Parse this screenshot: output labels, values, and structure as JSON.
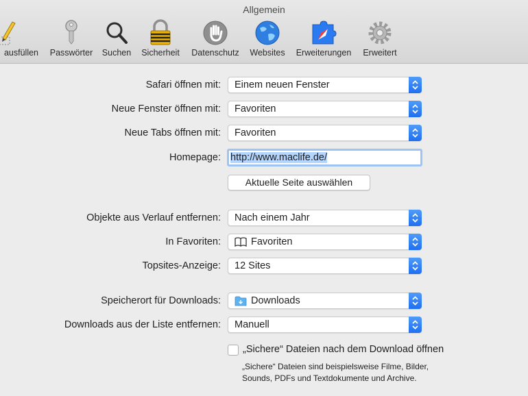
{
  "window": {
    "title": "Allgemein"
  },
  "toolbar": {
    "items": [
      {
        "label": "ausfüllen",
        "icon": "autofill-pencil-icon"
      },
      {
        "label": "Passwörter",
        "icon": "key-icon"
      },
      {
        "label": "Suchen",
        "icon": "magnifier-icon"
      },
      {
        "label": "Sicherheit",
        "icon": "padlock-icon"
      },
      {
        "label": "Datenschutz",
        "icon": "hand-icon"
      },
      {
        "label": "Websites",
        "icon": "globe-icon"
      },
      {
        "label": "Erweiterungen",
        "icon": "puzzle-icon"
      },
      {
        "label": "Erweitert",
        "icon": "gear-icon"
      }
    ]
  },
  "form": {
    "safari_open": {
      "label": "Safari öffnen mit:",
      "value": "Einem neuen Fenster"
    },
    "new_windows": {
      "label": "Neue Fenster öffnen mit:",
      "value": "Favoriten"
    },
    "new_tabs": {
      "label": "Neue Tabs öffnen mit:",
      "value": "Favoriten"
    },
    "homepage": {
      "label": "Homepage:",
      "value": "http://www.maclife.de/"
    },
    "set_current_button": "Aktuelle Seite auswählen",
    "history_remove": {
      "label": "Objekte aus Verlauf entfernen:",
      "value": "Nach einem Jahr"
    },
    "favorites": {
      "label": "In Favoriten:",
      "value": "Favoriten",
      "icon": "book-icon"
    },
    "topsites": {
      "label": "Topsites-Anzeige:",
      "value": "12 Sites"
    },
    "download_location": {
      "label": "Speicherort für Downloads:",
      "value": "Downloads",
      "icon": "folder-icon"
    },
    "downloads_remove": {
      "label": "Downloads aus der Liste entfernen:",
      "value": "Manuell"
    },
    "safe_files": {
      "label": "„Sichere“ Dateien nach dem Download öffnen",
      "checked": false,
      "hint_line1": "„Sichere“ Dateien sind beispielsweise Filme, Bilder,",
      "hint_line2": "Sounds, PDFs und Textdokumente und Archive."
    }
  },
  "colors": {
    "accent": "#2a7af2",
    "selection": "#b4d5fe",
    "focus_ring": "#9ec3f5"
  }
}
